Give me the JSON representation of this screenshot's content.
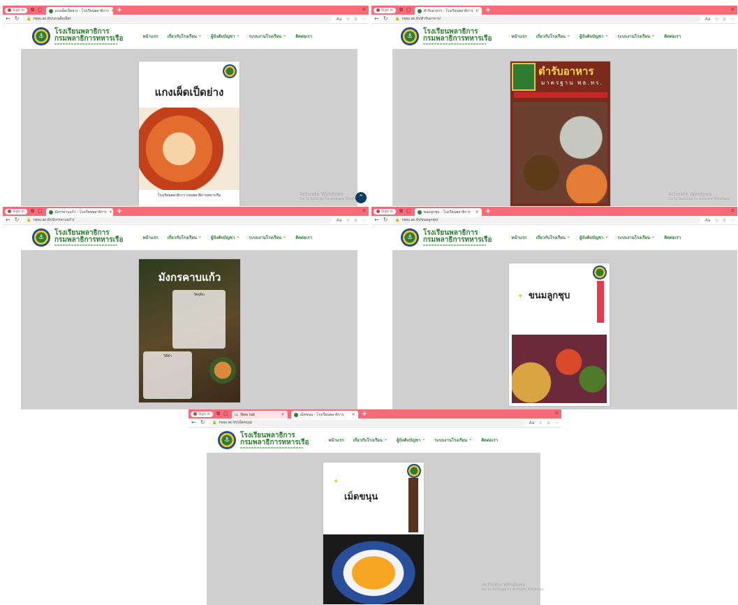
{
  "browser": {
    "sign_in": "Sign in",
    "tab_titles": [
      "แกงเผ็ดเป็ดย่าง - โรงเรียนพลาธิการ",
      "ตำรับอาหาร - โรงเรียนพลาธิการ",
      "มังกรคาบแก้ว - โรงเรียนพลาธิการ",
      "ขนมลูกชุบ - โรงเรียนพลาธิการ",
      "เม็ดขนุน - โรงเรียนพลาธิการ"
    ],
    "new_tab_title": "New tab",
    "url": "https://nssu.ac.th/",
    "url_paths": [
      "nssu.ac.th/แกงเผ็ดเป็ด/",
      "nssu.ac.th/ตำรับอาหาร/",
      "nssu.ac.th/มังกรคาบแก้ว/",
      "nssu.ac.th/ขนมลูกชุบ/",
      "nssu.ac.th/เม็ดขนุน/"
    ]
  },
  "site": {
    "name_line1": "โรงเรียนพลาธิการ",
    "name_line2": "กรมพลาธิการทหารเรือ",
    "menu": [
      "หน้าแรก",
      "เกี่ยวกับโรงเรียน",
      "ผู้บังคับบัญชา",
      "ระบบงานโรงเรียน",
      "ติดต่อเรา"
    ]
  },
  "documents": [
    {
      "title": "แกงเผ็ดเป็ดย่าง",
      "caption": "โรงเรียนพลาธิการ กรมพลาธิการทหารเรือ"
    },
    {
      "title": "ตำรับอาหาร",
      "subtitle": "มาตรฐาน พธ.ทร."
    },
    {
      "title": "มังกรคาบแก้ว",
      "section": "วัตถุดิบ",
      "section2": "วิธีทำ"
    },
    {
      "title": "ขนมลูกชุบ"
    },
    {
      "title": "เม็ดขนุน"
    }
  ],
  "watermark": {
    "line1": "Activate Windows",
    "line2": "Go to Settings to activate Windows."
  },
  "colors": {
    "tabbar": "#f56b7a",
    "brand_green": "#2e7d32",
    "content_gray": "#cfcfcf",
    "scroll_btn": "#0b3d63"
  },
  "icons": [
    "refresh-icon",
    "back-icon",
    "lock-icon",
    "star-icon",
    "more-icon",
    "scroll-up-icon"
  ]
}
